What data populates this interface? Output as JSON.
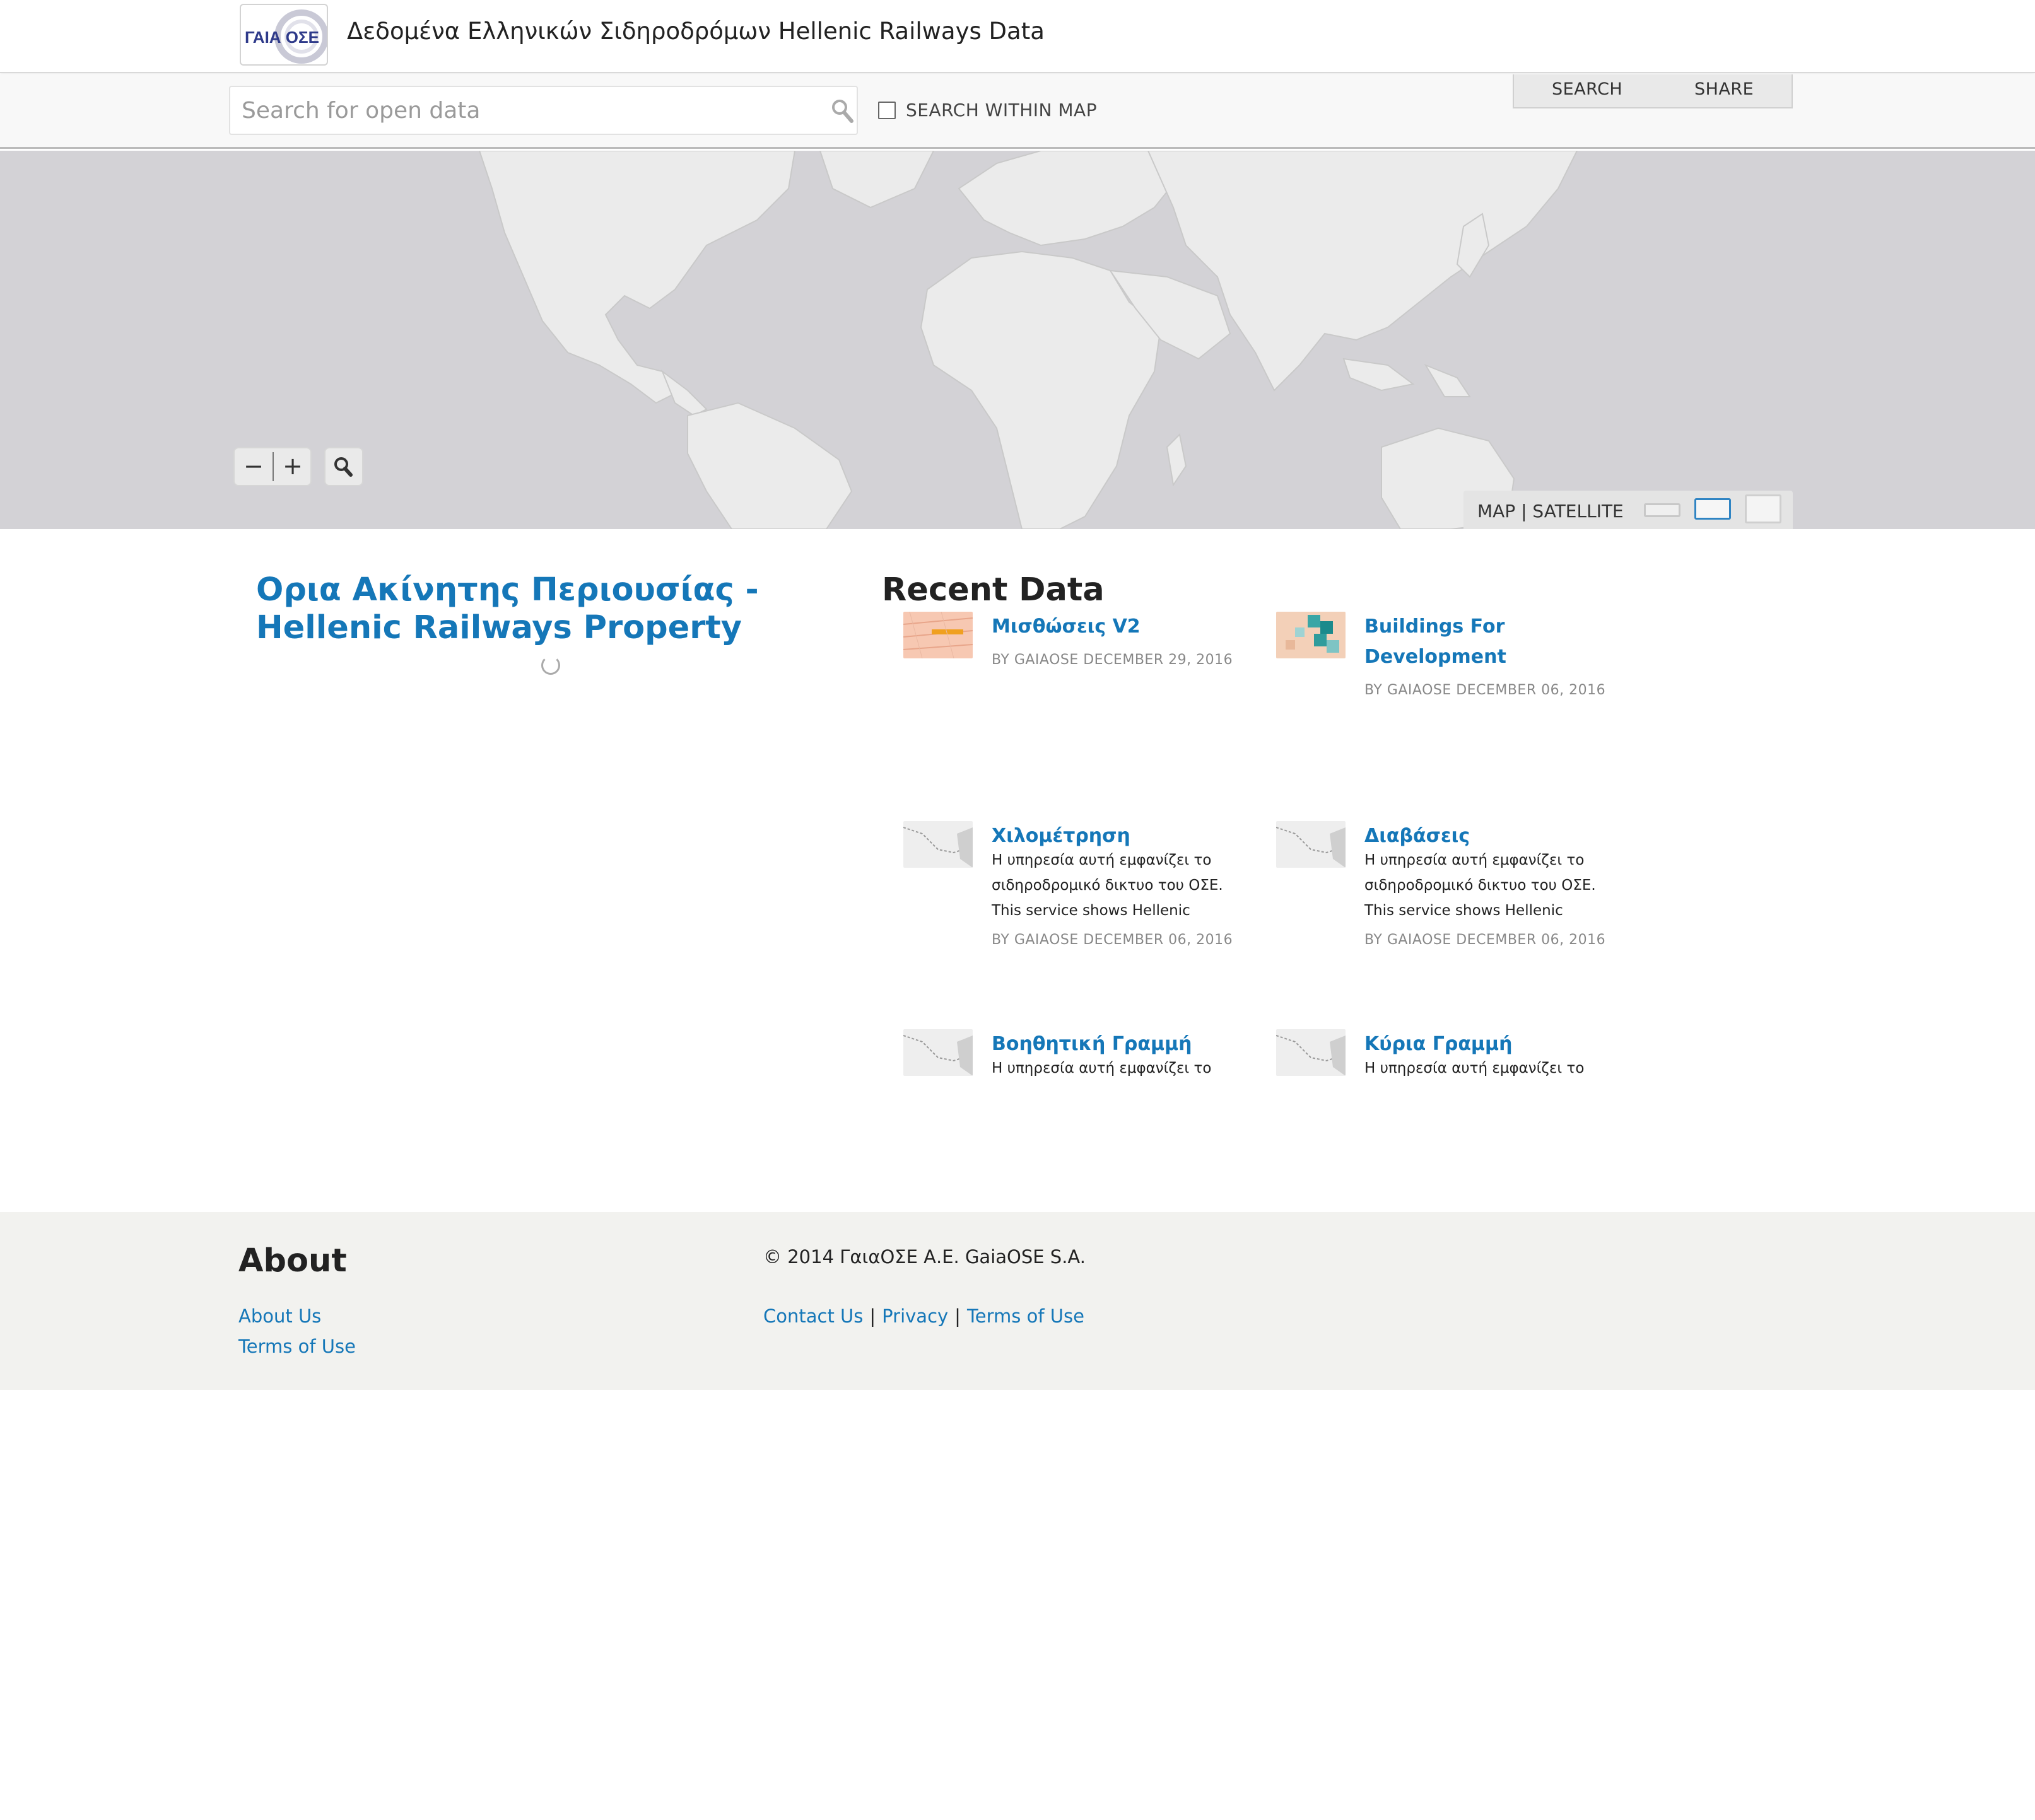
{
  "header": {
    "logo_text": "ΓΑΙΑ ΟΣΕ",
    "site_title": "Δεδομένα Ελληνικών Σιδηροδρόμων Hellenic Railways Data"
  },
  "toolbar": {
    "search_placeholder": "Search for open data",
    "search_within_map_label": "SEARCH WITHIN MAP",
    "search_within_map_checked": false,
    "tabs": [
      {
        "label": "SEARCH"
      },
      {
        "label": "SHARE"
      }
    ]
  },
  "map": {
    "zoom_out_label": "−",
    "zoom_in_label": "+",
    "basemap_label": "MAP | SATELLITE",
    "colors": {
      "land": "#ebebeb",
      "water": "#d3d2d6",
      "borders": "#c9c9c9"
    }
  },
  "feature": {
    "title": "Ορια Ακίνητης Περιουσίας - Hellenic Railways Property"
  },
  "recent": {
    "heading": "Recent Data",
    "items": [
      {
        "title": "Μισθώσεις V2",
        "description": "",
        "meta": "BY GAIAOSE DECEMBER 29, 2016",
        "thumb": "leases-thumbnail"
      },
      {
        "title": "Buildings For Development",
        "description": "",
        "meta": "BY GAIAOSE DECEMBER 06, 2016",
        "thumb": "buildings-thumbnail"
      },
      {
        "title": "Χιλομέτρηση",
        "description": "Η υπηρεσία αυτή εμφανίζει το σιδηροδρομικό δικτυο του ΟΣΕ. This service shows Hellenic",
        "meta": "BY GAIAOSE DECEMBER 06, 2016",
        "thumb": "railway-map-thumbnail"
      },
      {
        "title": "Διαβάσεις",
        "description": "Η υπηρεσία αυτή εμφανίζει το σιδηροδρομικό δικτυο του ΟΣΕ. This service shows Hellenic",
        "meta": "BY GAIAOSE DECEMBER 06, 2016",
        "thumb": "railway-map-thumbnail"
      },
      {
        "title": "Βοηθητική Γραμμή",
        "description": "Η υπηρεσία αυτή εμφανίζει το",
        "meta": "",
        "thumb": "railway-map-thumbnail"
      },
      {
        "title": "Κύρια Γραμμή",
        "description": "Η υπηρεσία αυτή εμφανίζει το",
        "meta": "",
        "thumb": "railway-map-thumbnail"
      }
    ]
  },
  "footer": {
    "about_heading": "About",
    "about_links": [
      "About Us",
      "Terms of Use"
    ],
    "copyright": "© 2014 ΓαιαΟΣΕ Α.Ε. GaiaOSE S.A.",
    "bottom_links": [
      "Contact Us",
      "Privacy",
      "Terms of Use"
    ]
  },
  "accent_color": "#1577b8"
}
